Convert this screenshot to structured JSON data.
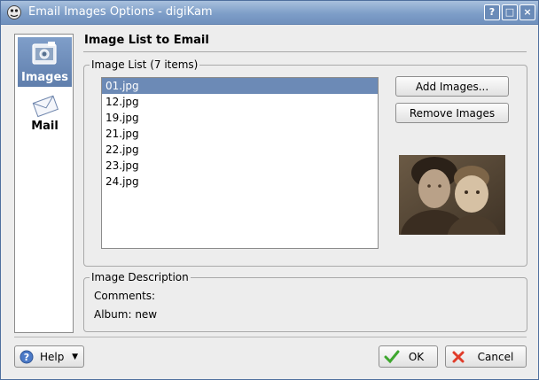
{
  "window": {
    "title": "Email Images Options - digiKam",
    "controls": [
      "?",
      "□",
      "×"
    ]
  },
  "sidebar": {
    "items": [
      {
        "label": "Images",
        "icon": "images-icon",
        "selected": true
      },
      {
        "label": "Mail",
        "icon": "mail-icon",
        "selected": false
      }
    ]
  },
  "page": {
    "title": "Image List to Email"
  },
  "image_list": {
    "group_title": "Image List (7 items)",
    "items": [
      "01.jpg",
      "12.jpg",
      "19.jpg",
      "21.jpg",
      "22.jpg",
      "23.jpg",
      "24.jpg"
    ],
    "selected_index": 0,
    "add_button": "Add Images...",
    "remove_button": "Remove Images"
  },
  "description": {
    "group_title": "Image Description",
    "comments_label": "Comments:",
    "album_label": "Album: new"
  },
  "footer": {
    "help_label": "Help",
    "ok_label": "OK",
    "cancel_label": "Cancel"
  },
  "colors": {
    "titlebar": "#7e9ec8",
    "selection": "#6c8ab6",
    "ok_check": "#3ea72e",
    "cancel_x": "#e03c2a"
  }
}
